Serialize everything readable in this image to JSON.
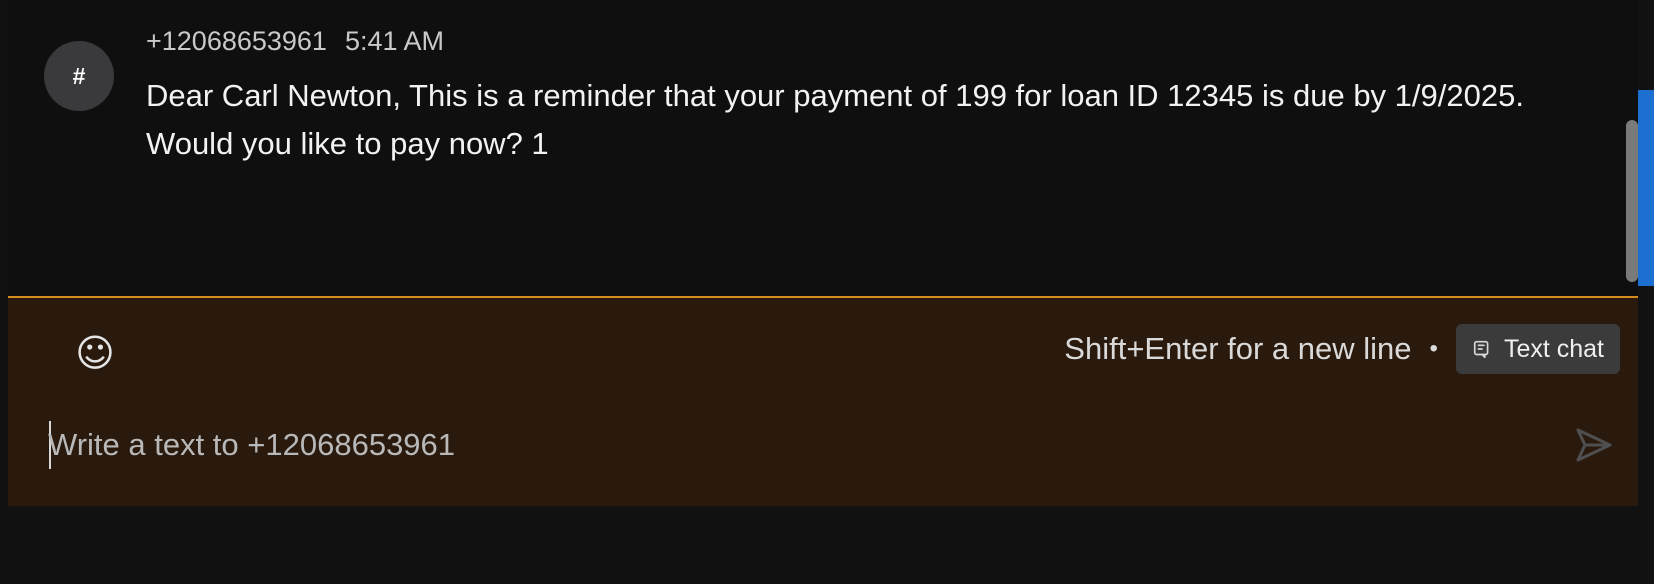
{
  "conversation": {
    "message": {
      "avatar_label": "#",
      "sender": "+12068653961",
      "time": "5:41 AM",
      "text": "Dear Carl Newton, This is a reminder that your payment of 199 for loan ID 12345 is due by 1/9/2025.  Would you like to pay now? 1"
    }
  },
  "composer": {
    "emoji_icon": "smiley-icon",
    "hint": "Shift+Enter for a new line",
    "separator": "•",
    "mode_button_label": "Text chat",
    "mode_icon": "text-chat-icon",
    "input_value": "",
    "input_placeholder": "Write a text to +12068653961",
    "send_icon": "send-icon"
  },
  "colors": {
    "background": "#111112",
    "composer_background": "#2a190d",
    "accent_border": "#d68a1f",
    "avatar_background": "#3a3a3c",
    "scrollbar_thumb": "#7a7a7a",
    "edge_accent": "#1e6fd2"
  }
}
